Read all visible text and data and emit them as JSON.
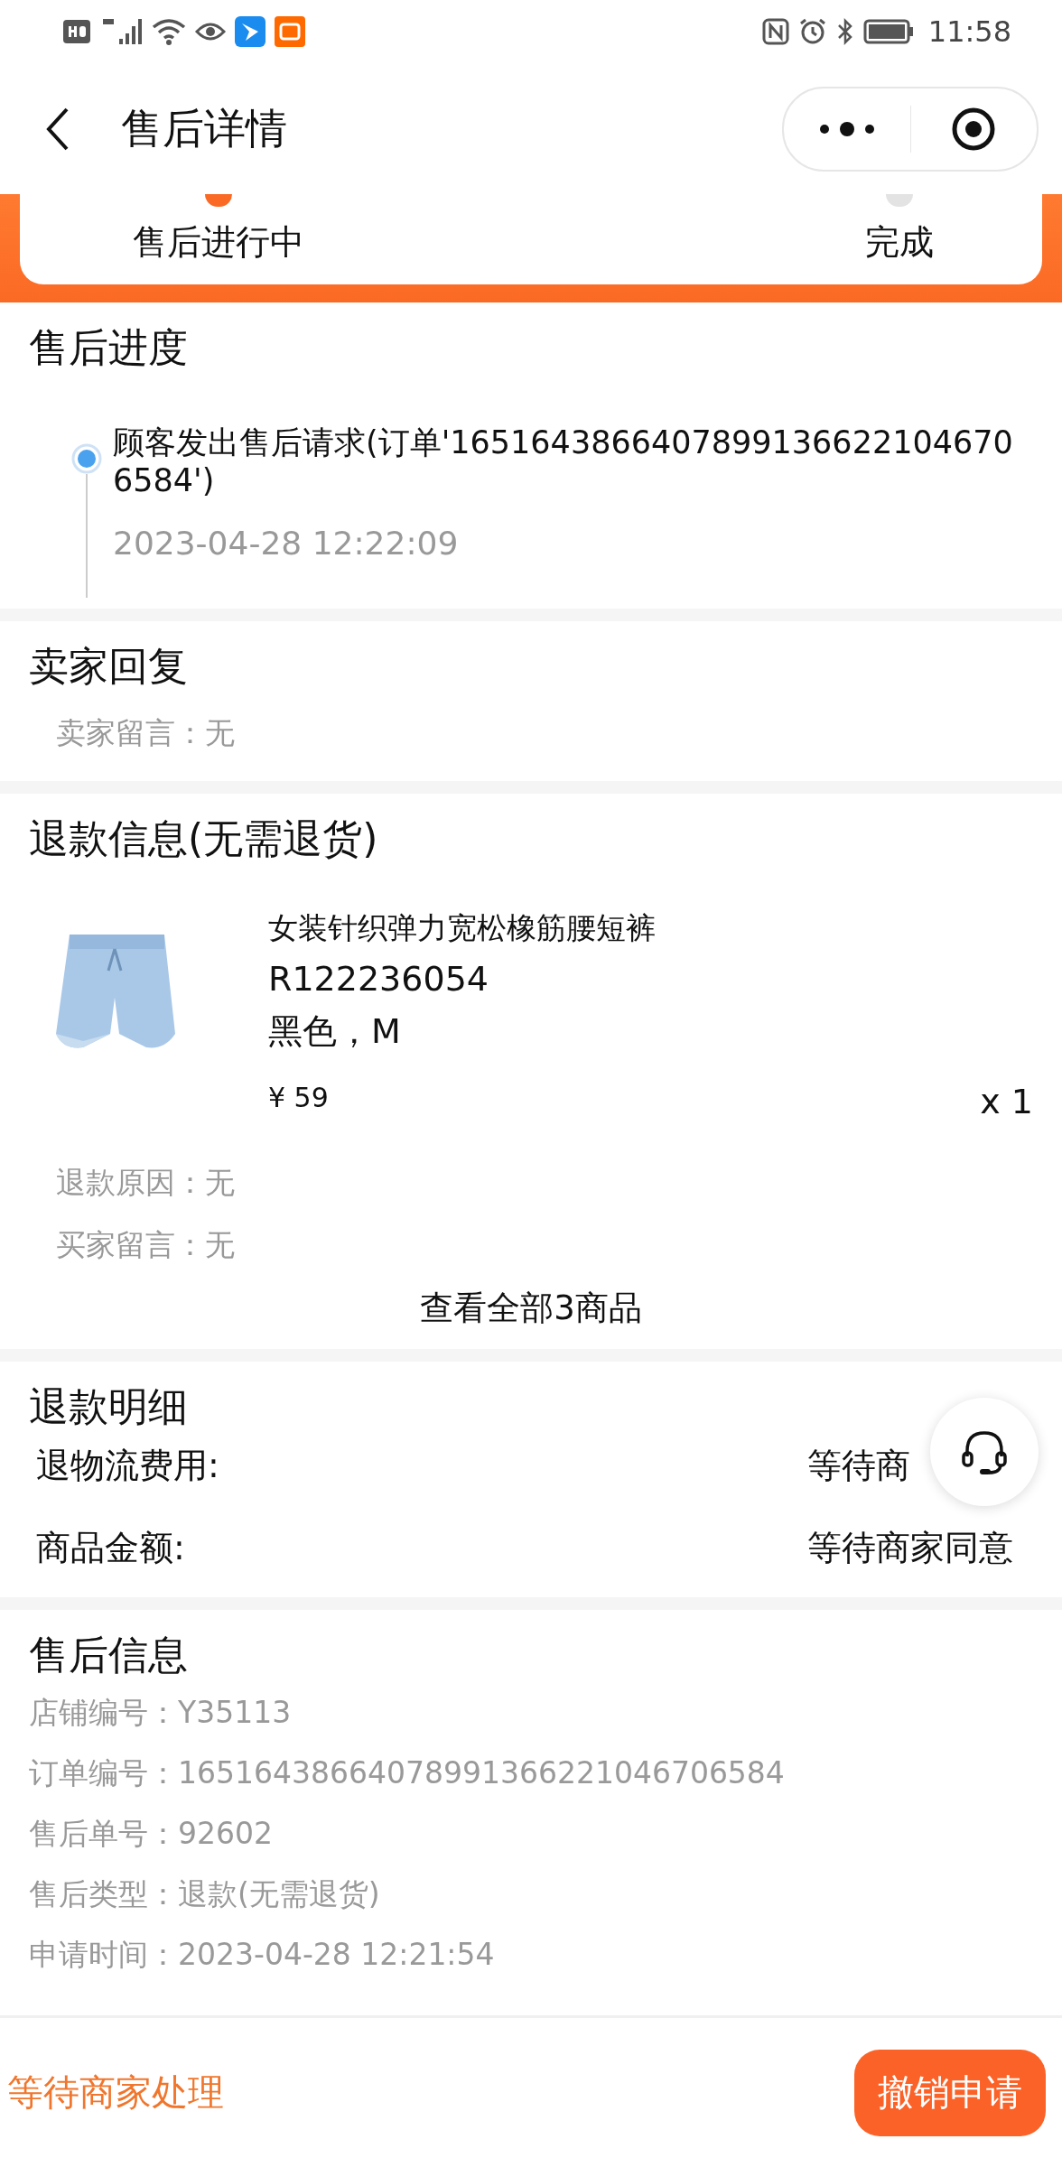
{
  "status_bar": {
    "time": "11:58"
  },
  "header": {
    "title": "售后详情"
  },
  "steps": [
    {
      "label": "售后进行中",
      "selected": true
    },
    {
      "label": "完成",
      "selected": false
    }
  ],
  "progress": {
    "title": "售后进度",
    "events": [
      {
        "text": "顾客发出售后请求(订单'16516438664078991366221046706584')",
        "time": "2023-04-28 12:22:09"
      }
    ]
  },
  "seller_reply": {
    "title": "卖家回复",
    "rows": [
      {
        "label": "卖家留言：",
        "value": "无"
      }
    ]
  },
  "refund_info": {
    "title": "退款信息(无需退货)",
    "product": {
      "name": "女装针织弹力宽松橡筋腰短裤",
      "code": "R122236054",
      "spec": "黑色，M",
      "price": "¥ 59",
      "quantity": "x 1"
    },
    "rows": [
      {
        "label": "退款原因：",
        "value": "无"
      },
      {
        "label": "买家留言：",
        "value": "无"
      }
    ],
    "view_all": "查看全部3商品"
  },
  "refund_detail": {
    "title": "退款明细",
    "rows": [
      {
        "label": "退物流费用:",
        "value": "等待商"
      },
      {
        "label": "商品金额:",
        "value": "等待商家同意"
      }
    ]
  },
  "after_sale_info": {
    "title": "售后信息",
    "rows": [
      {
        "label": "店铺编号：",
        "value": "Y35113"
      },
      {
        "label": "订单编号：",
        "value": "16516438664078991366221046706584"
      },
      {
        "label": "售后单号：",
        "value": "92602"
      },
      {
        "label": "售后类型：",
        "value": "退款(无需退货)"
      },
      {
        "label": "申请时间：",
        "value": "2023-04-28 12:21:54"
      }
    ]
  },
  "footer": {
    "status": "等待商家处理",
    "button": "撤销申请"
  }
}
